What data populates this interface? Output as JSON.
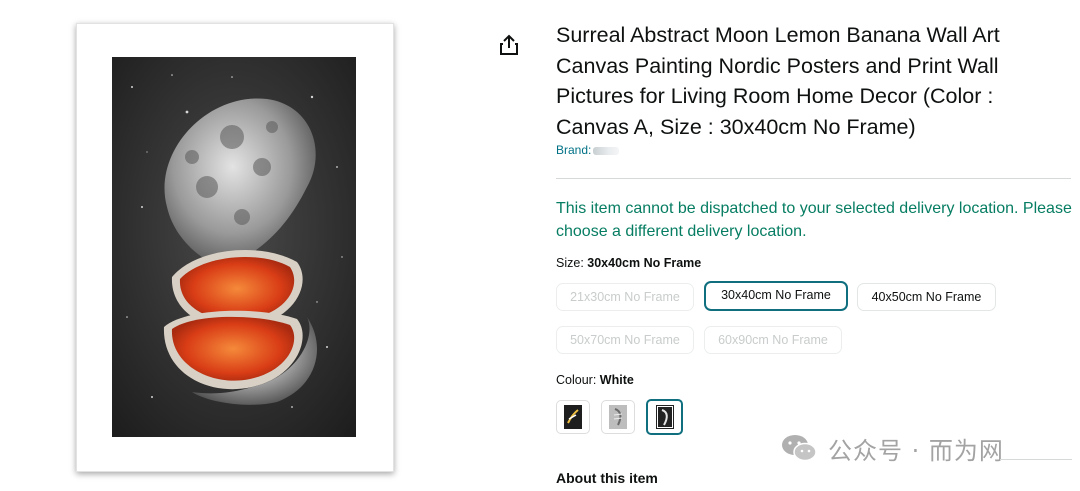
{
  "product": {
    "title": "Surreal Abstract Moon Lemon Banana Wall Art Canvas Painting Nordic Posters and Print Wall Pictures for Living Room Home Decor (Color : Canvas A, Size : 30x40cm No Frame)",
    "brand_label": "Brand:",
    "dispatch_message": "This item cannot be dispatched to your selected delivery location. Please choose a different delivery location."
  },
  "size": {
    "label": "Size: ",
    "selected": "30x40cm No Frame",
    "options": [
      {
        "label": "21x30cm No Frame",
        "state": "disabled"
      },
      {
        "label": "30x40cm No Frame",
        "state": "selected"
      },
      {
        "label": "40x50cm No Frame",
        "state": "available"
      },
      {
        "label": "50x70cm No Frame",
        "state": "disabled"
      },
      {
        "label": "60x90cm No Frame",
        "state": "disabled"
      }
    ]
  },
  "colour": {
    "label": "Colour: ",
    "selected": "White",
    "swatches": [
      {
        "icon": "black-art-thumbnail-icon",
        "state": "available"
      },
      {
        "icon": "grey-art-thumbnail-icon",
        "state": "available"
      },
      {
        "icon": "white-art-thumbnail-icon",
        "state": "selected"
      }
    ]
  },
  "about": {
    "heading": "About this item"
  },
  "watermark": {
    "text": "公众号 · 而为网"
  },
  "colors": {
    "link": "#007185",
    "success": "#067d62",
    "selected_border": "#0f6f7f",
    "divider": "#d5d9d9"
  }
}
